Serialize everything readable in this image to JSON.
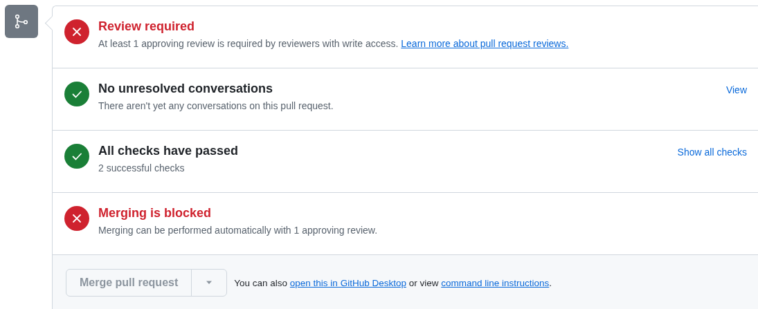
{
  "sections": [
    {
      "passed": false,
      "title": "Review required",
      "description": [
        {
          "kind": "text",
          "text": "At least 1 approving review is required by reviewers with write access. "
        },
        {
          "kind": "link",
          "text": "Learn more about pull request reviews."
        }
      ]
    },
    {
      "passed": true,
      "title": "No unresolved conversations",
      "description": [
        {
          "kind": "text",
          "text": "There aren't yet any conversations on this pull request."
        }
      ],
      "action": "View"
    },
    {
      "passed": true,
      "title": "All checks have passed",
      "description": [
        {
          "kind": "text",
          "text": "2 successful checks"
        }
      ],
      "action": "Show all checks"
    },
    {
      "passed": false,
      "title": "Merging is blocked",
      "description": [
        {
          "kind": "text",
          "text": "Merging can be performed automatically with 1 approving review."
        }
      ]
    }
  ],
  "merge": {
    "button": "Merge pull request",
    "disabled": true,
    "note": [
      {
        "kind": "text",
        "text": "You can also "
      },
      {
        "kind": "link",
        "text": "open this in GitHub Desktop"
      },
      {
        "kind": "text",
        "text": " or view "
      },
      {
        "kind": "link",
        "text": "command line instructions"
      },
      {
        "kind": "text",
        "text": "."
      }
    ]
  }
}
